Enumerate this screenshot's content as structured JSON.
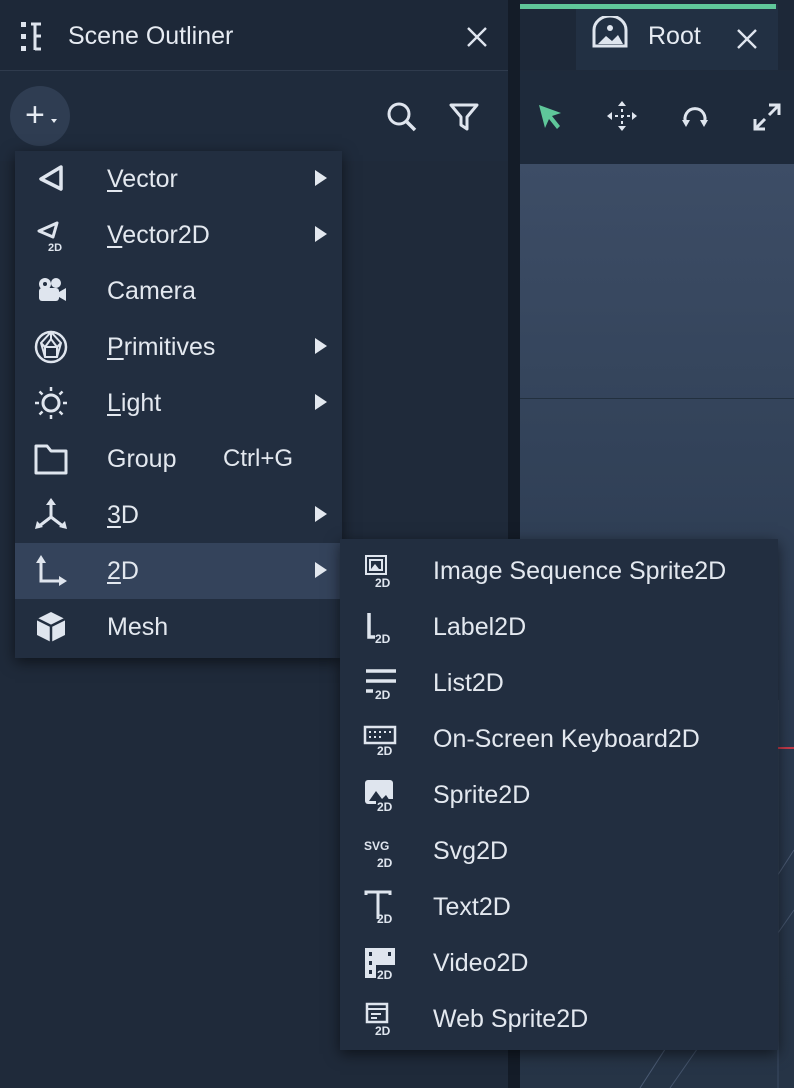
{
  "outliner": {
    "title": "Scene Outliner",
    "add_symbol": "+"
  },
  "viewport": {
    "tab_label": "Root"
  },
  "add_menu": {
    "items": [
      {
        "label": "Vector",
        "mnemonic": "V",
        "rest": "ector",
        "submenu": true,
        "icon": "vector-icon"
      },
      {
        "label": "Vector2D",
        "mnemonic": "V",
        "rest": "ector2D",
        "submenu": true,
        "icon": "vector2d-icon"
      },
      {
        "label": "Camera",
        "mnemonic": "",
        "rest": "Camera",
        "submenu": false,
        "icon": "camera-icon"
      },
      {
        "label": "Primitives",
        "mnemonic": "P",
        "rest": "rimitives",
        "submenu": true,
        "icon": "primitives-icon"
      },
      {
        "label": "Light",
        "mnemonic": "L",
        "rest": "ight",
        "submenu": true,
        "icon": "light-icon"
      },
      {
        "label": "Group",
        "mnemonic": "",
        "rest": "Group",
        "submenu": false,
        "shortcut": "Ctrl+G",
        "icon": "folder-icon"
      },
      {
        "label": "3D",
        "mnemonic": "3",
        "rest": "D",
        "submenu": true,
        "icon": "3d-axes-icon"
      },
      {
        "label": "2D",
        "mnemonic": "2",
        "rest": "D",
        "submenu": true,
        "active": true,
        "icon": "2d-axes-icon"
      },
      {
        "label": "Mesh",
        "mnemonic": "",
        "rest": "Mesh",
        "submenu": false,
        "icon": "mesh-cube-icon"
      }
    ]
  },
  "submenu_2d": {
    "items": [
      {
        "label": "Image Sequence Sprite2D",
        "icon": "image-sequence-icon"
      },
      {
        "label": "Label2D",
        "icon": "label2d-icon"
      },
      {
        "label": "List2D",
        "icon": "list2d-icon"
      },
      {
        "label": "On-Screen Keyboard2D",
        "icon": "keyboard2d-icon"
      },
      {
        "label": "Sprite2D",
        "icon": "sprite2d-icon"
      },
      {
        "label": "Svg2D",
        "icon": "svg2d-icon",
        "icon_text": "SVG"
      },
      {
        "label": "Text2D",
        "icon": "text2d-icon"
      },
      {
        "label": "Video2D",
        "icon": "video2d-icon"
      },
      {
        "label": "Web Sprite2D",
        "icon": "websprite2d-icon"
      }
    ],
    "badge": "2D"
  },
  "colors": {
    "accent_green": "#5fc79a",
    "panel": "#1f2a3a",
    "menu": "#222e40",
    "menu_active": "#34435b"
  }
}
